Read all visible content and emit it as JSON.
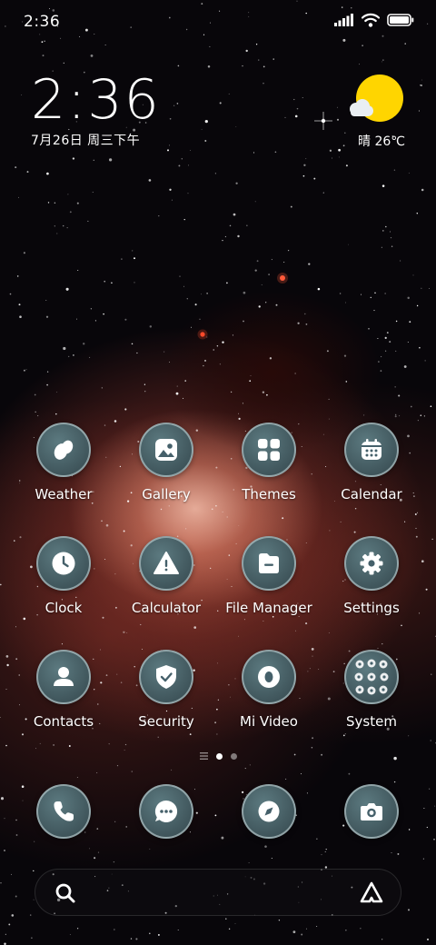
{
  "status_bar": {
    "time": "2:36",
    "icons": [
      "signal-icon",
      "wifi-icon",
      "battery-icon"
    ]
  },
  "clock_widget": {
    "time": "2:36",
    "date": "7月26日 周三下午"
  },
  "weather_widget": {
    "condition": "晴",
    "temperature": "26℃",
    "icon": "sunny-cloud-icon",
    "sun_color": "#FFD500"
  },
  "apps": [
    {
      "label": "Weather",
      "icon": "weather-icon"
    },
    {
      "label": "Gallery",
      "icon": "gallery-icon"
    },
    {
      "label": "Themes",
      "icon": "themes-icon"
    },
    {
      "label": "Calendar",
      "icon": "calendar-icon"
    },
    {
      "label": "Clock",
      "icon": "clock-icon"
    },
    {
      "label": "Calculator",
      "icon": "calculator-icon"
    },
    {
      "label": "File Manager",
      "icon": "file-manager-icon"
    },
    {
      "label": "Settings",
      "icon": "settings-icon"
    },
    {
      "label": "Contacts",
      "icon": "contacts-icon"
    },
    {
      "label": "Security",
      "icon": "security-icon"
    },
    {
      "label": "Mi Video",
      "icon": "mi-video-icon"
    },
    {
      "label": "System",
      "icon": "system-folder-icon"
    }
  ],
  "page_indicator": {
    "pages": 2,
    "current": 1
  },
  "dock": [
    {
      "icon": "phone-icon"
    },
    {
      "icon": "messages-icon"
    },
    {
      "icon": "browser-icon"
    },
    {
      "icon": "camera-icon"
    }
  ],
  "search_bar": {
    "left_icon": "search-icon",
    "right_icon": "assistant-icon"
  }
}
